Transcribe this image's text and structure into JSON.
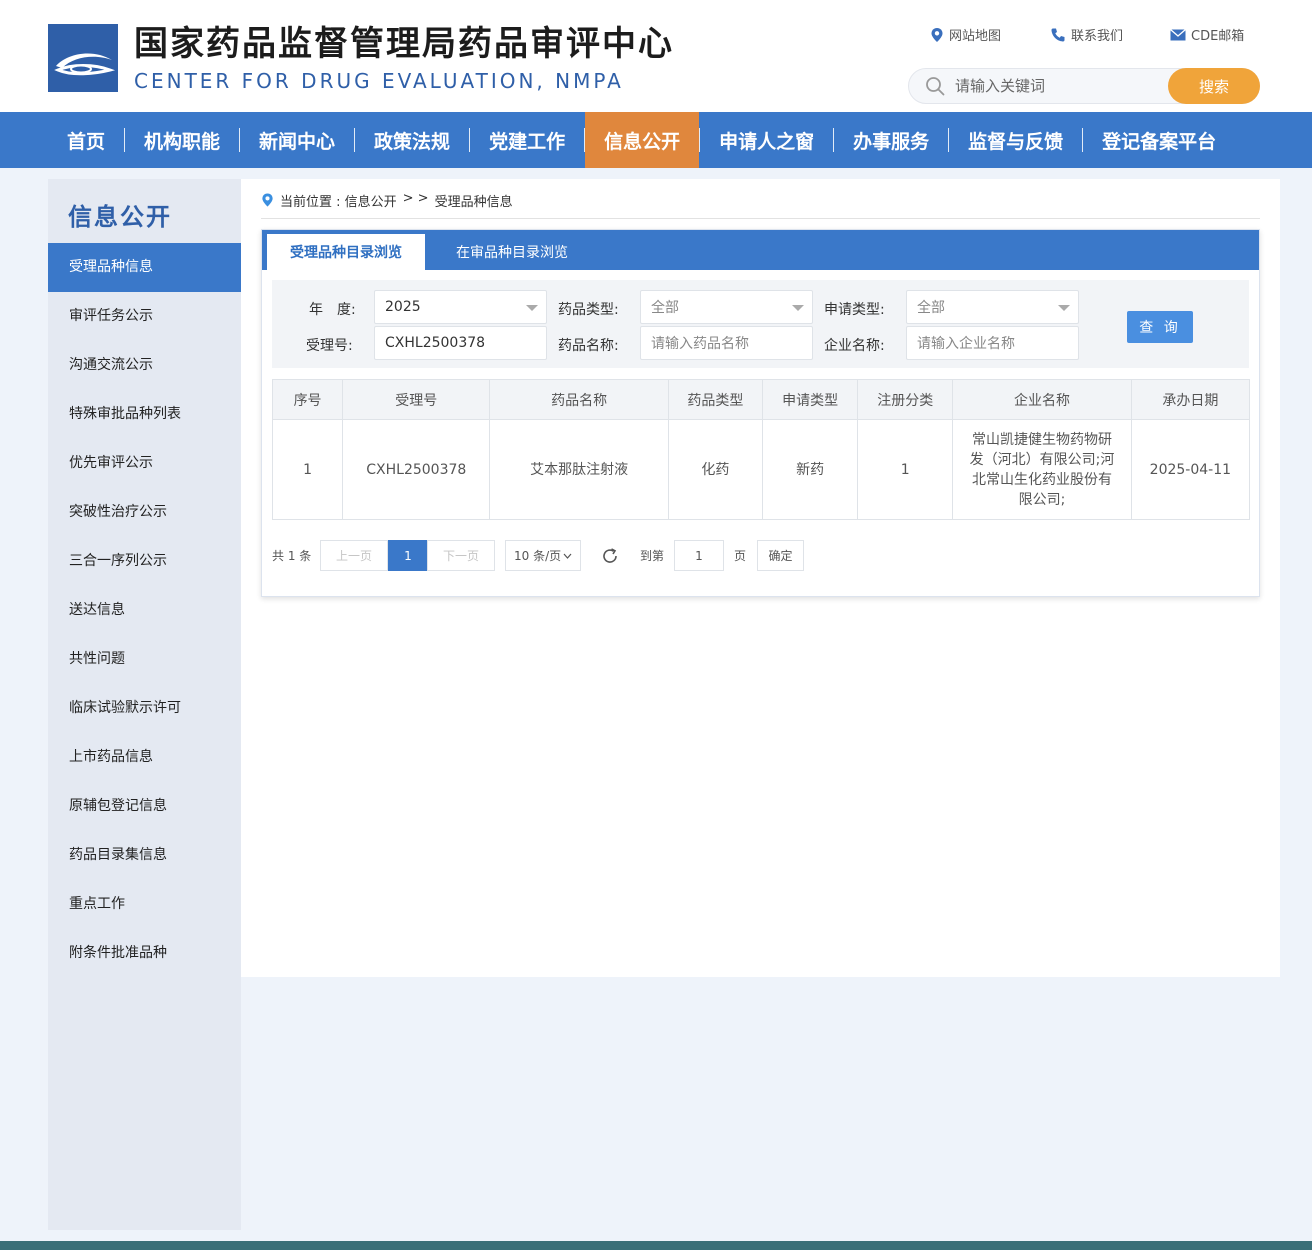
{
  "header": {
    "title": "国家药品监督管理局药品审评中心",
    "subtitle": "CENTER FOR DRUG EVALUATION, NMPA",
    "links": {
      "sitemap": "网站地图",
      "contact": "联系我们",
      "mail": "CDE邮箱"
    },
    "search": {
      "placeholder": "请输入关键词",
      "button_label": "搜索"
    }
  },
  "nav": {
    "items": [
      "首页",
      "机构职能",
      "新闻中心",
      "政策法规",
      "党建工作",
      "信息公开",
      "申请人之窗",
      "办事服务",
      "监督与反馈",
      "登记备案平台"
    ],
    "active_index": 5
  },
  "sidebar": {
    "title": "信息公开",
    "items": [
      "受理品种信息",
      "审评任务公示",
      "沟通交流公示",
      "特殊审批品种列表",
      "优先审评公示",
      "突破性治疗公示",
      "三合一序列公示",
      "送达信息",
      "共性问题",
      "临床试验默示许可",
      "上市药品信息",
      "原辅包登记信息",
      "药品目录集信息",
      "重点工作",
      "附条件批准品种"
    ],
    "active_index": 0
  },
  "breadcrumb": {
    "prefix": "当前位置 : 信息公开",
    "separator": "> >",
    "current": "受理品种信息"
  },
  "tabs": {
    "received": "受理品种目录浏览",
    "in_review": "在审品种目录浏览"
  },
  "filter": {
    "year_label": "年　度:",
    "year_value": "2025",
    "drug_type_label": "药品类型:",
    "drug_type_value": "全部",
    "apply_type_label": "申请类型:",
    "apply_type_value": "全部",
    "accept_no_label": "受理号:",
    "accept_no_value": "CXHL2500378",
    "drug_name_label": "药品名称:",
    "drug_name_placeholder": "请输入药品名称",
    "company_label": "企业名称:",
    "company_placeholder": "请输入企业名称",
    "query_label": "查 询"
  },
  "table": {
    "columns": [
      "序号",
      "受理号",
      "药品名称",
      "药品类型",
      "申请类型",
      "注册分类",
      "企业名称",
      "承办日期"
    ],
    "rows": [
      [
        "1",
        "CXHL2500378",
        "艾本那肽注射液",
        "化药",
        "新药",
        "1",
        "常山凯捷健生物药物研发（河北）有限公司;河北常山生化药业股份有限公司;",
        "2025-04-11"
      ]
    ]
  },
  "pagination": {
    "total": "共 1 条",
    "prev": "上一页",
    "current": "1",
    "next": "下一页",
    "page_size": "10 条/页",
    "goto_label": "到第",
    "goto_value": "1",
    "page_suffix": "页",
    "confirm": "确定"
  },
  "colors": {
    "nav_blue": "#3a78c9",
    "nav_active": "#e0873d",
    "search_button": "#f0a43a",
    "brand_blue": "#2f5fa8"
  }
}
